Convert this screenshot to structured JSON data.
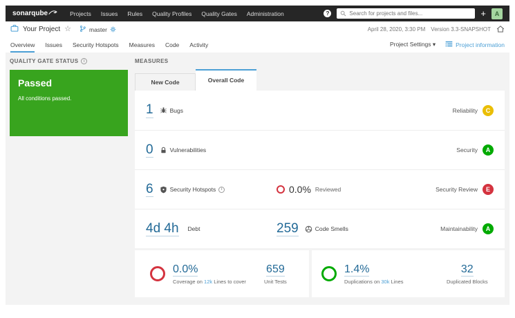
{
  "navbar": {
    "logo": "sonarqube",
    "items": [
      "Projects",
      "Issues",
      "Rules",
      "Quality Profiles",
      "Quality Gates",
      "Administration"
    ],
    "help_glyph": "?",
    "search_placeholder": "Search for projects and files...",
    "plus_glyph": "+",
    "avatar_initial": "A"
  },
  "project_header": {
    "title": "Your Project",
    "star_glyph": "☆",
    "branch": "master",
    "date": "April 28, 2020, 3:30 PM",
    "version": "Version 3.3-SNAPSHOT"
  },
  "nav_tabs": {
    "items": [
      "Overview",
      "Issues",
      "Security Hotspots",
      "Measures",
      "Code",
      "Activity"
    ],
    "active": "Overview",
    "project_settings": "Project Settings",
    "caret_glyph": "▾",
    "project_information": "Project information"
  },
  "quality_gate": {
    "heading": "QUALITY GATE STATUS",
    "info_glyph": "i",
    "status": "Passed",
    "description": "All conditions passed."
  },
  "measures": {
    "heading": "MEASURES",
    "tabs": {
      "new_code": "New Code",
      "overall_code": "Overall Code",
      "active": "Overall Code"
    },
    "bugs": {
      "value": "1",
      "label": "Bugs",
      "domain": "Reliability",
      "rating": "C"
    },
    "vulnerabilities": {
      "value": "0",
      "label": "Vulnerabilities",
      "domain": "Security",
      "rating": "A"
    },
    "security_hotspots": {
      "value": "6",
      "label": "Security Hotspots",
      "info_glyph": "i",
      "reviewed_value": "0.0%",
      "reviewed_label": "Reviewed",
      "domain": "Security Review",
      "rating": "E"
    },
    "maintainability": {
      "debt_value": "4d 4h",
      "debt_label": "Debt",
      "smells_value": "259",
      "smells_label": "Code Smells",
      "domain": "Maintainability",
      "rating": "A"
    },
    "coverage": {
      "value": "0.0%",
      "label_prefix": "Coverage on",
      "lines_link": "12k",
      "label_suffix": "Lines to cover",
      "tests_value": "659",
      "tests_label": "Unit Tests"
    },
    "duplications": {
      "value": "1.4%",
      "label_prefix": "Duplications on",
      "lines_link": "30k",
      "label_suffix": "Lines",
      "blocks_value": "32",
      "blocks_label": "Duplicated Blocks"
    }
  },
  "colors": {
    "navbar_bg": "#262626",
    "accent_blue": "#4b9fd5",
    "number_blue": "#236a97",
    "passed_green": "#38a41e",
    "rating_a": "#00aa00",
    "rating_c": "#eabe06",
    "rating_e": "#d4333f",
    "ring_red": "#d4333f",
    "ring_green": "#00aa00",
    "background_gray": "#f3f3f3"
  }
}
